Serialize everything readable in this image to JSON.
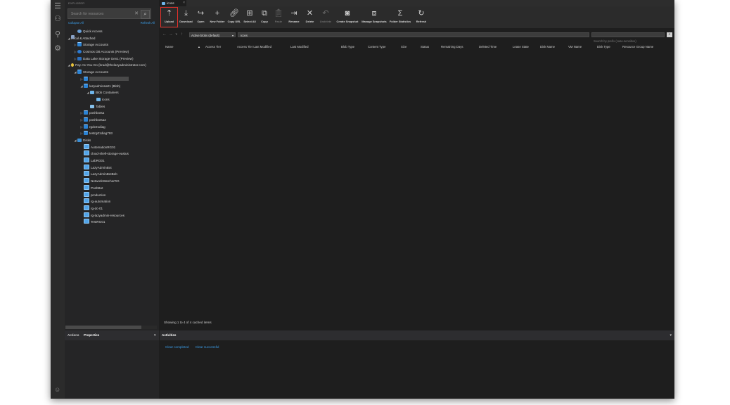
{
  "explorer": {
    "title": "EXPLORER",
    "search_placeholder": "Search for resources",
    "collapse_all": "Collapse All",
    "refresh_all": "Refresh All",
    "tree": [
      {
        "label": "Quick Access",
        "indent": 1,
        "twisty": "",
        "icon": "quick"
      },
      {
        "label": "Local & Attached",
        "indent": 0,
        "twisty": "◢",
        "icon": "link"
      },
      {
        "label": "Storage Accounts",
        "indent": 1,
        "twisty": "▷",
        "icon": "storage"
      },
      {
        "label": "Cosmos DB Accounts (Preview)",
        "indent": 1,
        "twisty": "▷",
        "icon": "cosmos"
      },
      {
        "label": "Data Lake Storage Gen1 (Preview)",
        "indent": 1,
        "twisty": "▷",
        "icon": "lake"
      },
      {
        "label": "Pay-As-You-Go (brad@thelazyadministrator.com)",
        "indent": 0,
        "twisty": "◢",
        "icon": "key"
      },
      {
        "label": "Storage Accounts",
        "indent": 1,
        "twisty": "◢",
        "icon": "storage"
      },
      {
        "label": "",
        "indent": 2,
        "twisty": "▷",
        "icon": "storage",
        "redacted": true
      },
      {
        "label": "lazyadminsa01 (Blob)",
        "indent": 2,
        "twisty": "◢",
        "icon": "storage"
      },
      {
        "label": "Blob Containers",
        "indent": 3,
        "twisty": "◢",
        "icon": "blob"
      },
      {
        "label": "icons",
        "indent": 4,
        "twisty": "",
        "icon": "blob"
      },
      {
        "label": "Tables",
        "indent": 3,
        "twisty": "",
        "icon": "table"
      },
      {
        "label": "poshbotsa",
        "indent": 2,
        "twisty": "▷",
        "icon": "storage"
      },
      {
        "label": "poshbotsa2",
        "indent": 2,
        "twisty": "▷",
        "icon": "storage"
      },
      {
        "label": "rgdc01diag",
        "indent": 2,
        "twisty": "▷",
        "icon": "storage"
      },
      {
        "label": "testrg01diag793",
        "indent": 2,
        "twisty": "▷",
        "icon": "storage"
      },
      {
        "label": "Disks",
        "indent": 1,
        "twisty": "◢",
        "icon": "disk"
      },
      {
        "label": "AutomationRG01",
        "indent": 2,
        "twisty": "",
        "icon": "grp"
      },
      {
        "label": "cloud-shell-storage-eastus",
        "indent": 2,
        "twisty": "",
        "icon": "grp"
      },
      {
        "label": "LabRG01",
        "indent": 2,
        "twisty": "",
        "icon": "grp"
      },
      {
        "label": "LazyAdminBot",
        "indent": 2,
        "twisty": "",
        "icon": "grp"
      },
      {
        "label": "LazyAdminBotBeb",
        "indent": 2,
        "twisty": "",
        "icon": "grp"
      },
      {
        "label": "NetworkWatcherRG",
        "indent": 2,
        "twisty": "",
        "icon": "grp"
      },
      {
        "label": "PoshBot",
        "indent": 2,
        "twisty": "",
        "icon": "grp"
      },
      {
        "label": "production",
        "indent": 2,
        "twisty": "",
        "icon": "grp"
      },
      {
        "label": "rg-automation",
        "indent": 2,
        "twisty": "",
        "icon": "grp"
      },
      {
        "label": "rg-dc-01",
        "indent": 2,
        "twisty": "",
        "icon": "grp"
      },
      {
        "label": "rg-lazyadmin-resources",
        "indent": 2,
        "twisty": "",
        "icon": "grp"
      },
      {
        "label": "TestRG01",
        "indent": 2,
        "twisty": "",
        "icon": "grp"
      }
    ],
    "bottom_tabs": {
      "actions": "Actions",
      "properties": "Properties"
    }
  },
  "tab": {
    "label": "icons",
    "close": "×"
  },
  "toolbar": [
    {
      "label": "Upload",
      "glyph": "⇡",
      "name": "upload-button",
      "highlight": true
    },
    {
      "label": "Download",
      "glyph": "⤓",
      "name": "download-button"
    },
    {
      "label": "Open",
      "glyph": "↪",
      "name": "open-button"
    },
    {
      "label": "New Folder",
      "glyph": "+",
      "name": "new-folder-button"
    },
    {
      "label": "Copy URL",
      "glyph": "🔗︎",
      "name": "copy-url-button"
    },
    {
      "label": "Select All",
      "glyph": "⊞",
      "name": "select-all-button"
    },
    {
      "label": "Copy",
      "glyph": "⧉",
      "name": "copy-button"
    },
    {
      "label": "Paste",
      "glyph": "📋︎",
      "name": "paste-button",
      "disabled": true
    },
    {
      "label": "Rename",
      "glyph": "⇥",
      "name": "rename-button"
    },
    {
      "label": "Delete",
      "glyph": "✕",
      "name": "delete-button"
    },
    {
      "label": "Undelete",
      "glyph": "↶",
      "name": "undelete-button",
      "disabled": true
    },
    {
      "label": "Create Snapshot",
      "glyph": "◙",
      "name": "create-snapshot-button"
    },
    {
      "label": "Manage Snapshots",
      "glyph": "⧈",
      "name": "manage-snapshots-button"
    },
    {
      "label": "Folder Statistics",
      "glyph": "Σ",
      "name": "folder-statistics-button"
    },
    {
      "label": "Refresh",
      "glyph": "↻",
      "name": "refresh-button"
    }
  ],
  "address": {
    "view_mode": "Active blobs (default)",
    "path": "icons",
    "prefix_placeholder": "Search by prefix (case-sensitive)"
  },
  "columns": [
    "Name",
    "Access Tier",
    "Access Tier Last Modified",
    "Last Modified",
    "Blob Type",
    "Content Type",
    "Size",
    "Status",
    "Remaining Days",
    "Deleted Time",
    "Lease State",
    "Disk Name",
    "VM Name",
    "Disk Type",
    "Resource Group Name"
  ],
  "status": "Showing 1 to 4 of 4 cached items",
  "activities": {
    "title": "Activities",
    "clear_completed": "Clear completed",
    "clear_successful": "Clear successful"
  }
}
